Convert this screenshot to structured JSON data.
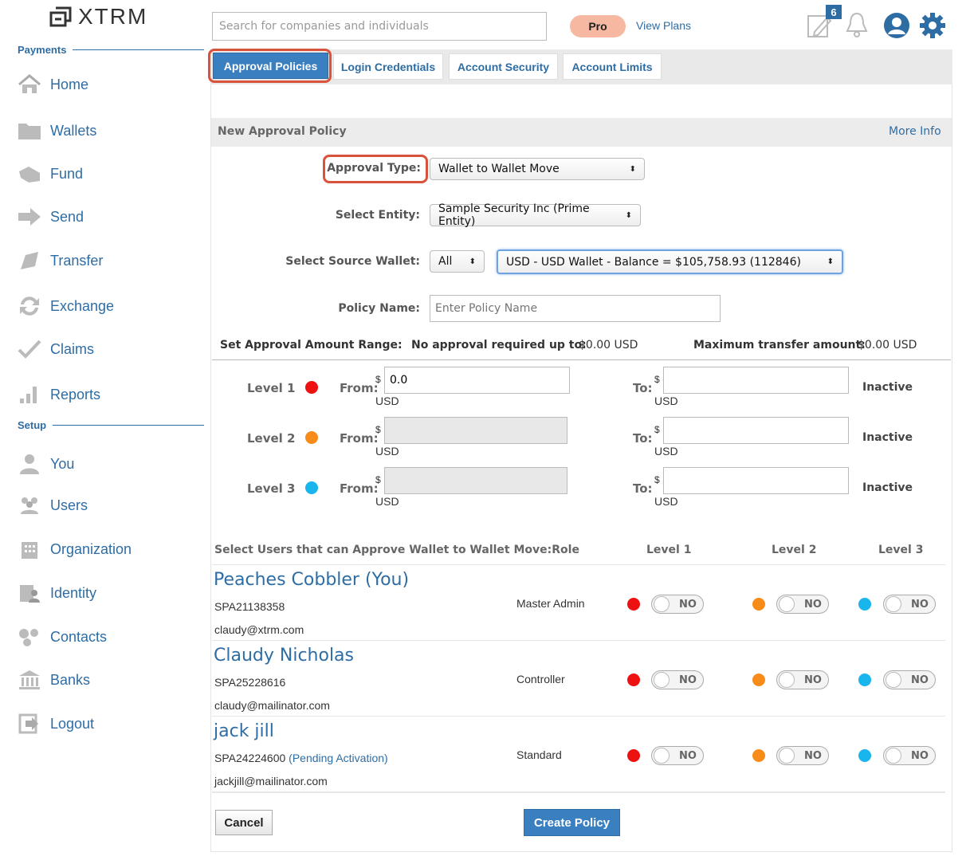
{
  "app": {
    "logo_text": "XTRM"
  },
  "sidebar": {
    "section_payments": "Payments",
    "section_setup": "Setup",
    "items": [
      {
        "label": "Home",
        "icon": "home-icon"
      },
      {
        "label": "Wallets",
        "icon": "folder-icon"
      },
      {
        "label": "Fund",
        "icon": "fund-icon"
      },
      {
        "label": "Send",
        "icon": "send-arrow-icon"
      },
      {
        "label": "Transfer",
        "icon": "transfer-icon"
      },
      {
        "label": "Exchange",
        "icon": "exchange-icon"
      },
      {
        "label": "Claims",
        "icon": "checkmark-icon"
      },
      {
        "label": "Reports",
        "icon": "bar-chart-icon"
      },
      {
        "label": "You",
        "icon": "user-icon"
      },
      {
        "label": "Users",
        "icon": "users-icon"
      },
      {
        "label": "Organization",
        "icon": "building-icon"
      },
      {
        "label": "Identity",
        "icon": "identity-icon"
      },
      {
        "label": "Contacts",
        "icon": "contacts-icon"
      },
      {
        "label": "Banks",
        "icon": "bank-icon"
      },
      {
        "label": "Logout",
        "icon": "logout-icon"
      }
    ]
  },
  "header": {
    "search_placeholder": "Search for companies and individuals",
    "pro_badge": "Pro",
    "view_plans": "View Plans",
    "notification_count": "6"
  },
  "tabs": [
    "Approval Policies",
    "Login Credentials",
    "Account Security",
    "Account Limits"
  ],
  "form": {
    "title": "New Approval Policy",
    "more_info": "More Info",
    "approval_type_label": "Approval Type:",
    "approval_type_value": "Wallet to Wallet Move",
    "select_entity_label": "Select Entity:",
    "select_entity_value": "Sample Security Inc (Prime Entity)",
    "source_wallet_label": "Select Source Wallet:",
    "source_wallet_filter": "All",
    "source_wallet_value": "USD - USD Wallet - Balance = $105,758.93 (112846)",
    "policy_name_label": "Policy Name:",
    "policy_name_placeholder": "Enter Policy Name",
    "range_label": "Set Approval Amount Range:",
    "no_approval_label": "No approval required up to:",
    "no_approval_value": "$0.00 USD",
    "max_transfer_label": "Maximum transfer amount:",
    "max_transfer_value": "$0.00 USD"
  },
  "levels": [
    {
      "label": "Level 1",
      "color": "#ee1111",
      "from_label": "From:",
      "from_value": "0.0",
      "to_label": "To:",
      "currency_symbol": "$",
      "currency": "USD",
      "status": "Inactive"
    },
    {
      "label": "Level 2",
      "color": "#f78c1a",
      "from_label": "From:",
      "from_value": "",
      "to_label": "To:",
      "currency_symbol": "$",
      "currency": "USD",
      "status": "Inactive"
    },
    {
      "label": "Level 3",
      "color": "#19b6ee",
      "from_label": "From:",
      "from_value": "",
      "to_label": "To:",
      "currency_symbol": "$",
      "currency": "USD",
      "status": "Inactive"
    }
  ],
  "users_table": {
    "header_users": "Select Users that can Approve Wallet to Wallet Move:",
    "header_role": "Role",
    "header_level1": "Level 1",
    "header_level2": "Level 2",
    "header_level3": "Level 3",
    "toggle_off_label": "NO",
    "rows": [
      {
        "name": "Peaches Cobbler (You)",
        "id": "SPA21138358",
        "pending": "",
        "email": "claudy@xtrm.com",
        "role": "Master Admin"
      },
      {
        "name": "Claudy Nicholas",
        "id": "SPA25228616",
        "pending": "",
        "email": "claudy@mailinator.com",
        "role": "Controller"
      },
      {
        "name": "jack jill",
        "id": "SPA24224600",
        "pending": "(Pending Activation)",
        "email": "jackjill@mailinator.com",
        "role": "Standard"
      }
    ]
  },
  "actions": {
    "cancel": "Cancel",
    "create": "Create Policy"
  }
}
